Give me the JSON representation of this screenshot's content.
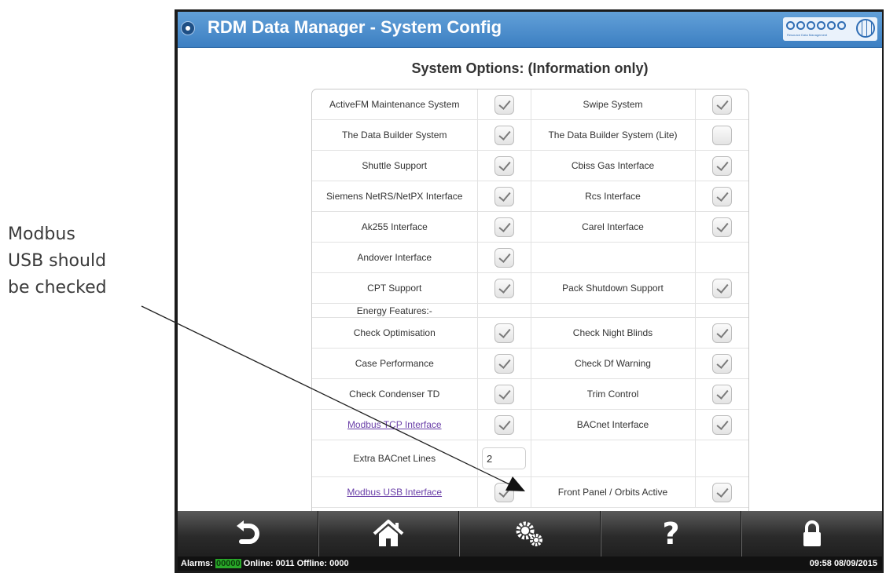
{
  "annotation": {
    "lines": [
      "Modbus",
      "USB should",
      "be checked"
    ]
  },
  "header": {
    "title": "RDM Data Manager - System Config",
    "logo_tagline": "Resource Data Management"
  },
  "section_title": "System Options: (Information only)",
  "options": {
    "r1": {
      "l_label": "ActiveFM Maintenance System",
      "l_checked": true,
      "r_label": "Swipe System",
      "r_checked": true
    },
    "r2": {
      "l_label": "The Data Builder System",
      "l_checked": true,
      "r_label": "The Data Builder System (Lite)",
      "r_checked": false
    },
    "r3": {
      "l_label": "Shuttle Support",
      "l_checked": true,
      "r_label": "Cbiss Gas Interface",
      "r_checked": true
    },
    "r4": {
      "l_label": "Siemens NetRS/NetPX Interface",
      "l_checked": true,
      "r_label": "Rcs Interface",
      "r_checked": true
    },
    "r5": {
      "l_label": "Ak255 Interface",
      "l_checked": true,
      "r_label": "Carel Interface",
      "r_checked": true
    },
    "r6": {
      "l_label": "Andover Interface",
      "l_checked": true
    },
    "r7": {
      "l_label": "CPT Support",
      "l_checked": true,
      "r_label": "Pack Shutdown Support",
      "r_checked": true
    },
    "energy_header": "Energy Features:-",
    "r8": {
      "l_label": "Check Optimisation",
      "l_checked": true,
      "r_label": "Check Night Blinds",
      "r_checked": true
    },
    "r9": {
      "l_label": "Case Performance",
      "l_checked": true,
      "r_label": "Check Df Warning",
      "r_checked": true
    },
    "r10": {
      "l_label": "Check Condenser TD",
      "l_checked": true,
      "r_label": "Trim Control",
      "r_checked": true
    },
    "r11": {
      "l_label": "Modbus TCP Interface",
      "l_checked": true,
      "r_label": "BACnet Interface",
      "r_checked": true
    },
    "r12": {
      "l_label": "Extra BACnet Lines",
      "value": "2"
    },
    "r13": {
      "l_label": "Modbus USB Interface",
      "l_checked": true,
      "r_label": "Front Panel / Orbits Active",
      "r_checked": true
    }
  },
  "toolbar": {
    "back_icon": "back-arrow-icon",
    "home_icon": "home-icon",
    "settings_icon": "gears-icon",
    "help_label": "?",
    "lock_icon": "lock-icon"
  },
  "status": {
    "alarms_label": "Alarms:",
    "alarms_value": "00000",
    "online_label": "Online: 0011",
    "offline_label": "Offline: 0000",
    "datetime": "09:58 08/09/2015"
  },
  "colors": {
    "title_bar": "#4a8ccc",
    "link": "#6a3fa8",
    "alarm_ok": "#29a829"
  }
}
